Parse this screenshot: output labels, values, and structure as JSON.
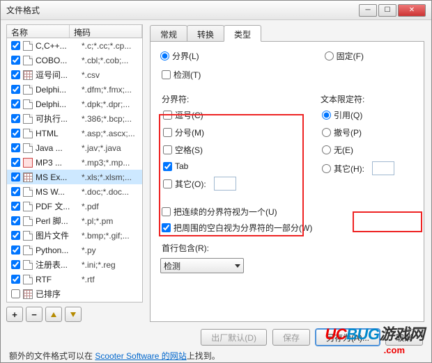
{
  "window": {
    "title": "文件格式"
  },
  "list": {
    "headers": {
      "name": "名称",
      "mask": "掩码"
    },
    "items": [
      {
        "checked": true,
        "icon": "doc",
        "name": "C,C++...",
        "mask": "*.c;*.cc;*.cp..."
      },
      {
        "checked": true,
        "icon": "doc",
        "name": "COBO...",
        "mask": "*.cbl;*.cob;..."
      },
      {
        "checked": true,
        "icon": "grid",
        "name": "逗号间...",
        "mask": "*.csv"
      },
      {
        "checked": true,
        "icon": "doc",
        "name": "Delphi...",
        "mask": "*.dfm;*.fmx;..."
      },
      {
        "checked": true,
        "icon": "doc",
        "name": "Delphi...",
        "mask": "*.dpk;*.dpr;..."
      },
      {
        "checked": true,
        "icon": "doc",
        "name": "可执行...",
        "mask": "*.386;*.bcp;..."
      },
      {
        "checked": true,
        "icon": "doc",
        "name": "HTML",
        "mask": "*.asp;*.ascx;..."
      },
      {
        "checked": true,
        "icon": "doc",
        "name": "Java ...",
        "mask": "*.jav;*.java"
      },
      {
        "checked": true,
        "icon": "mp3",
        "name": "MP3 ...",
        "mask": "*.mp3;*.mp..."
      },
      {
        "checked": true,
        "icon": "grid",
        "name": "MS Ex...",
        "mask": "*.xls;*.xlsm;...",
        "selected": true
      },
      {
        "checked": true,
        "icon": "doc",
        "name": "MS W...",
        "mask": "*.doc;*.doc..."
      },
      {
        "checked": true,
        "icon": "doc",
        "name": "PDF 文...",
        "mask": "*.pdf"
      },
      {
        "checked": true,
        "icon": "doc",
        "name": "Perl 脚...",
        "mask": "*.pl;*.pm"
      },
      {
        "checked": true,
        "icon": "doc",
        "name": "图片文件",
        "mask": "*.bmp;*.gif;..."
      },
      {
        "checked": true,
        "icon": "doc",
        "name": "Python...",
        "mask": "*.py"
      },
      {
        "checked": true,
        "icon": "doc",
        "name": "注册表...",
        "mask": "*.ini;*.reg"
      },
      {
        "checked": true,
        "icon": "doc",
        "name": "RTF",
        "mask": "*.rtf"
      },
      {
        "checked": false,
        "icon": "grid",
        "name": "已排序",
        "mask": ""
      }
    ]
  },
  "leftbtns": {
    "add": "+",
    "remove": "−"
  },
  "tabs": {
    "general": "常规",
    "convert": "转换",
    "type": "类型"
  },
  "panel": {
    "delimited": "分界(L)",
    "fixed": "固定(F)",
    "detect": "检测(T)",
    "delim_title": "分界符:",
    "comma": "逗号(C)",
    "semicolon": "分号(M)",
    "space": "空格(S)",
    "tab": "Tab",
    "other": "其它(O):",
    "text_title": "文本限定符:",
    "quote": "引用(Q)",
    "revoke": "撤号(P)",
    "none": "无(E)",
    "other2": "其它(H):",
    "treat_consec": "把连续的分界符视为一个(U)",
    "treat_blank": "把周围的空白视为分界符的一部分(W)",
    "firstline": "首行包含(R):",
    "firstline_val": "检测"
  },
  "footer": {
    "factory": "出厂默认(D)",
    "save": "保存",
    "saveas": "另存为(A)...",
    "cancel": "取消",
    "note_pre": "额外的文件格式可以在 ",
    "note_link": "Scooter Software 的网站",
    "note_post": "上找到。"
  },
  "watermark": {
    "brand_u": "UC",
    "brand_b": "BUG",
    "suffix": "游戏网",
    "url": ".com"
  }
}
